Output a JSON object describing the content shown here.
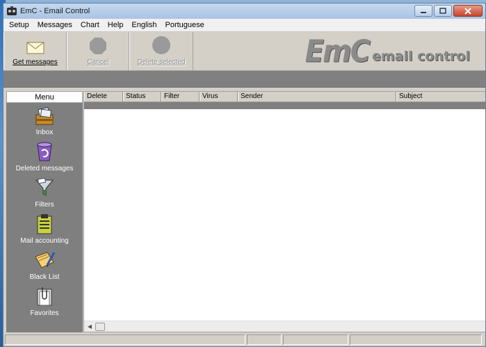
{
  "window": {
    "title": "EmC - Email Control"
  },
  "menubar": [
    "Setup",
    "Messages",
    "Chart",
    "Help",
    "English",
    "Portuguese"
  ],
  "toolbar": {
    "get_messages": "Get messages",
    "cancel": "Cancel",
    "delete_selected": "Delete selected"
  },
  "logo": {
    "main": "EmC",
    "sub": "email control"
  },
  "sidebar": {
    "header": "Menu",
    "items": [
      {
        "label": "Inbox",
        "icon": "inbox-icon"
      },
      {
        "label": "Deleted messages",
        "icon": "recycle-bin-icon"
      },
      {
        "label": "Filters",
        "icon": "funnel-filter-icon"
      },
      {
        "label": "Mail accounting",
        "icon": "clipboard-icon"
      },
      {
        "label": "Black List",
        "icon": "notebook-pen-icon"
      },
      {
        "label": "Favorites",
        "icon": "folder-clip-icon"
      }
    ]
  },
  "table": {
    "columns": [
      "Delete",
      "Status",
      "Filter",
      "Virus",
      "Sender",
      "Subject"
    ],
    "rows": []
  },
  "statusbar": {
    "panels": [
      "",
      "",
      "",
      ""
    ]
  },
  "colors": {
    "accent": "#808080",
    "title_bg": "#b9d0ea",
    "close": "#c7442d"
  }
}
